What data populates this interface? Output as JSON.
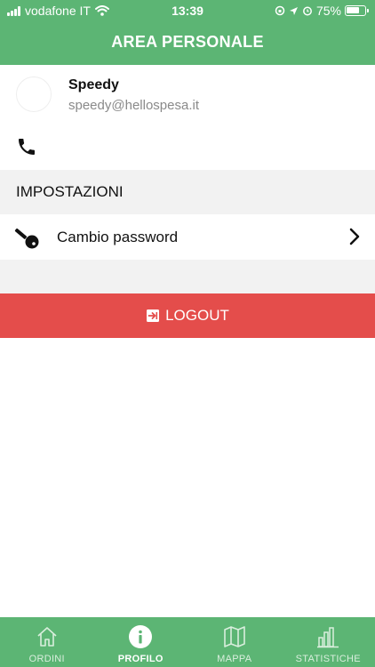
{
  "status_bar": {
    "carrier": "vodafone IT",
    "time": "13:39",
    "battery": "75%",
    "battery_level": 0.75
  },
  "header": {
    "title": "AREA PERSONALE"
  },
  "profile": {
    "name": "Speedy",
    "email": "speedy@hellospesa.it",
    "phone": ""
  },
  "settings": {
    "section_title": "IMPOSTAZIONI",
    "items": [
      {
        "label": "Cambio password",
        "icon": "key-icon"
      }
    ]
  },
  "logout": {
    "label": "LOGOUT",
    "icon": "logout-icon"
  },
  "tabs": [
    {
      "label": "ORDINI",
      "icon": "home-icon",
      "active": false
    },
    {
      "label": "PROFILO",
      "icon": "info-icon",
      "active": true
    },
    {
      "label": "MAPPA",
      "icon": "map-icon",
      "active": false
    },
    {
      "label": "STATISTICHE",
      "icon": "bar-chart-icon",
      "active": false
    }
  ],
  "colors": {
    "primary": "#5cb574",
    "danger": "#e44d4b",
    "section_bg": "#f2f2f2"
  }
}
